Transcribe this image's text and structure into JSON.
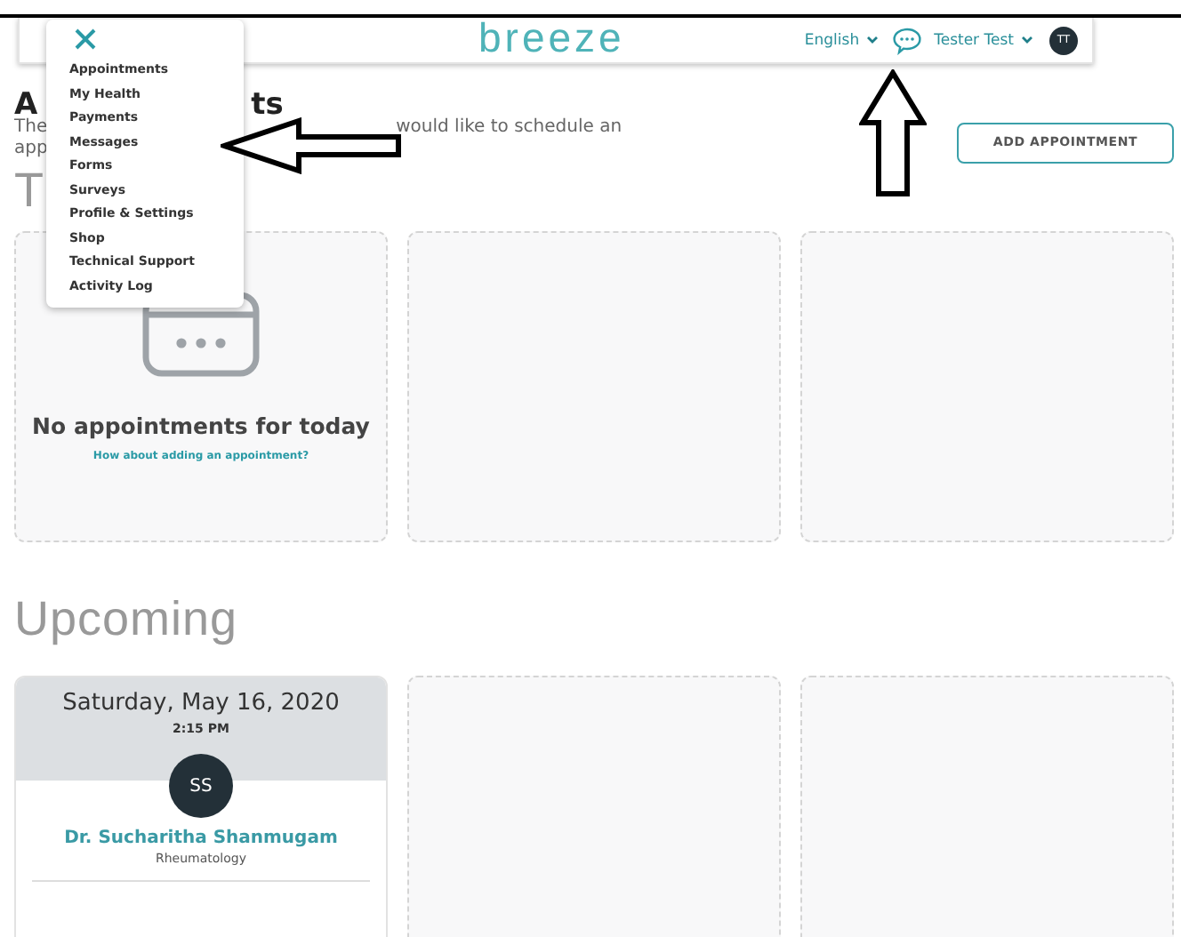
{
  "header": {
    "logo": "breeze",
    "language": "English",
    "user": "Tester Test",
    "avatar": "TT"
  },
  "menu": {
    "items": [
      "Appointments",
      "My Health",
      "Payments",
      "Messages",
      "Forms",
      "Surveys",
      "Profile & Settings",
      "Shop",
      "Technical Support",
      "Activity Log"
    ]
  },
  "page": {
    "title_parts": [
      "A",
      "ts"
    ],
    "intro_parts": [
      "The",
      "would like to schedule an",
      "app"
    ],
    "button": "ADD APPOINTMENT"
  },
  "today": {
    "heading": "T",
    "cards": [
      {
        "kind": "empty",
        "message": "No appointments for today",
        "link": "How about adding an appointment?"
      },
      {
        "kind": "blank"
      },
      {
        "kind": "blank"
      }
    ]
  },
  "upcoming": {
    "heading": "Upcoming",
    "cards": [
      {
        "kind": "appointment",
        "date": "Saturday, May 16, 2020",
        "time": "2:15 PM",
        "initials": "SS",
        "doctor": "Dr. Sucharitha Shanmugam",
        "specialty": "Rheumatology"
      },
      {
        "kind": "blank"
      },
      {
        "kind": "blank"
      }
    ]
  }
}
